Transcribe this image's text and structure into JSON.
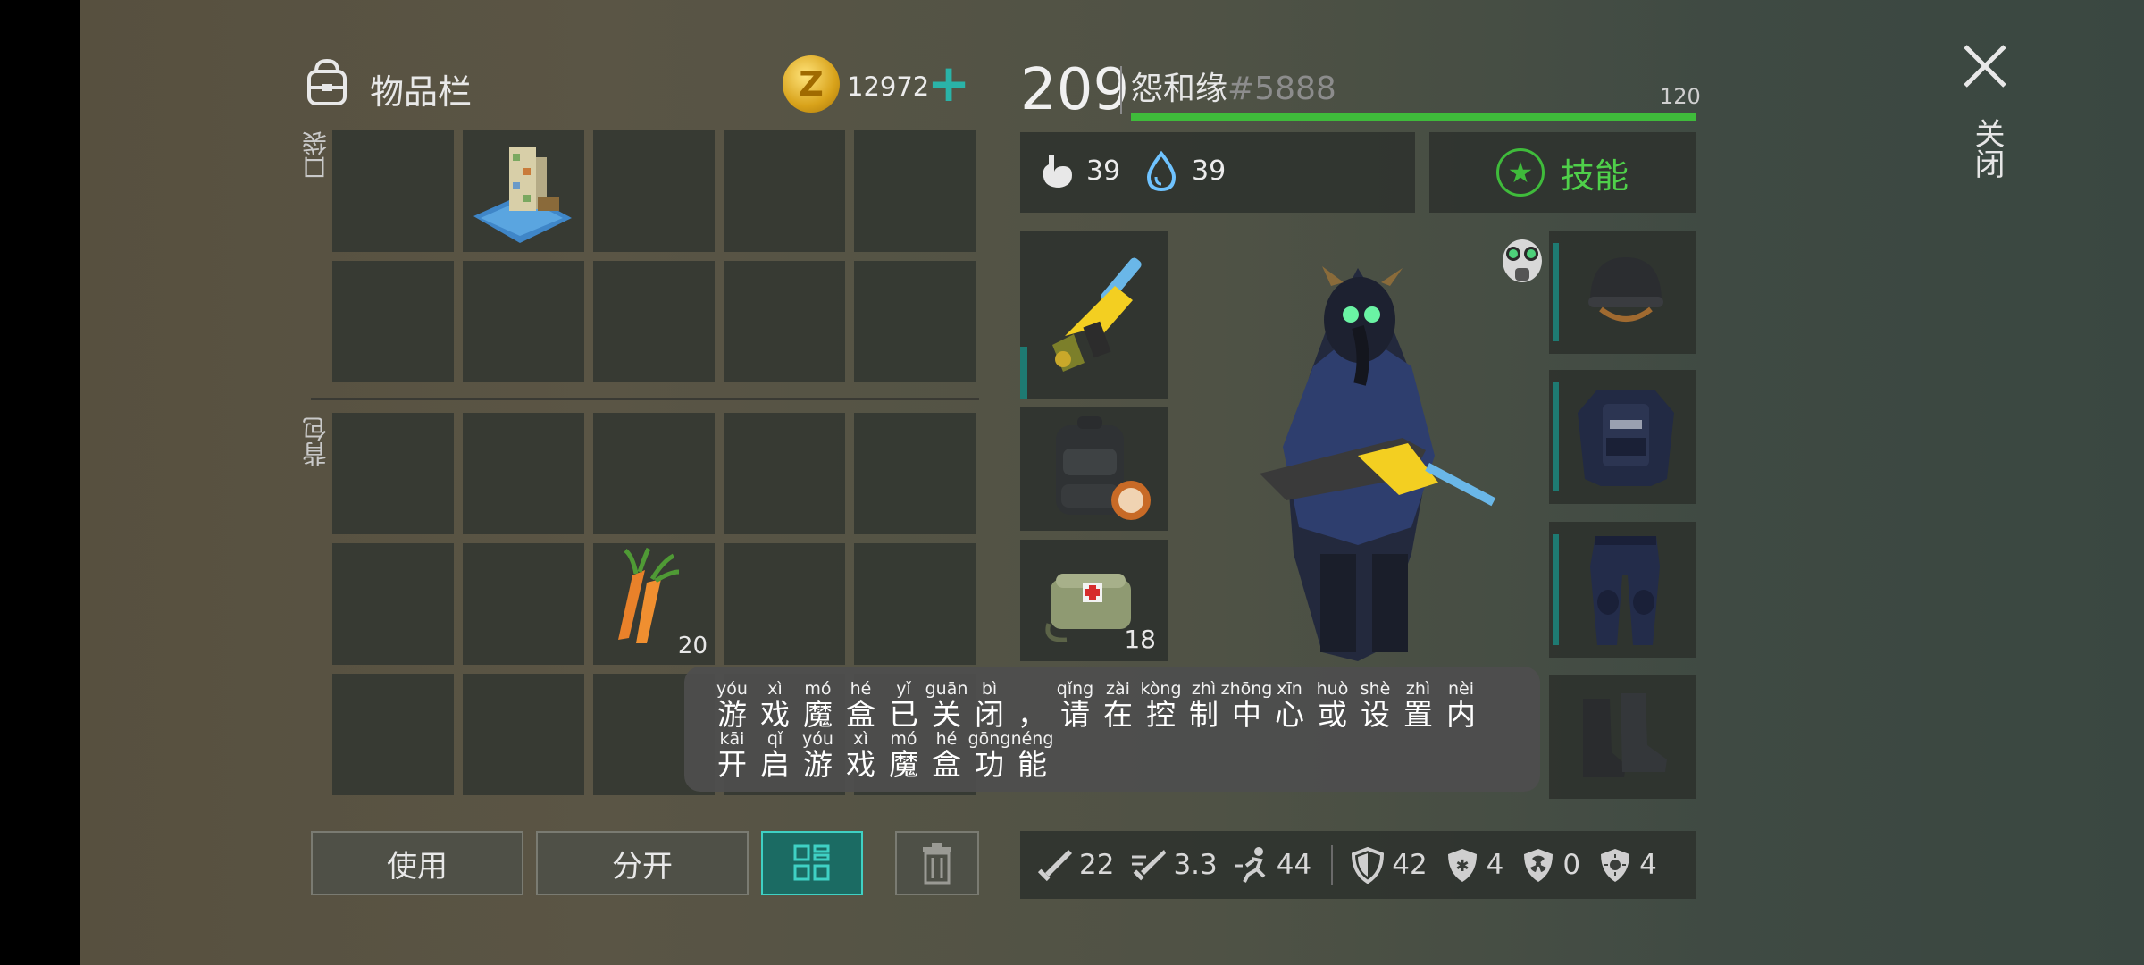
{
  "inventory": {
    "title": "物品栏",
    "coins": "12972",
    "pocket_label": "口袋",
    "backpack_label": "背包",
    "pocket_items": [
      {
        "slot": 1,
        "name": "building-kit-icon"
      }
    ],
    "backpack_items": [
      {
        "slot": 7,
        "name": "carrot-icon",
        "qty": "20"
      }
    ]
  },
  "buttons": {
    "use": "使用",
    "split": "分开"
  },
  "player": {
    "level": "209",
    "name": "怨和缘",
    "tag": "#5888",
    "xp_cap": "120",
    "xp_fill": 1.0,
    "hunger": "39",
    "thirst": "39",
    "skills_label": "技能"
  },
  "quick_slots": [
    {
      "name": "yellow-weapon-icon",
      "qty": ""
    },
    {
      "name": "backpack-icon",
      "qty": ""
    },
    {
      "name": "medkit-bag-icon",
      "qty": "18"
    }
  ],
  "equipment": [
    "helmet-icon",
    "body-armor-icon",
    "pants-icon",
    "boots-icon"
  ],
  "combat_stats": {
    "damage": "22",
    "attack_speed": "3.3",
    "move_speed": "44",
    "armor": "42",
    "cold_resist": "4",
    "radiation_resist": "0",
    "heat_resist": "4"
  },
  "close_label": "关闭",
  "toast": {
    "line1": [
      {
        "py": "yóu",
        "hz": "游"
      },
      {
        "py": "xì",
        "hz": "戏"
      },
      {
        "py": "mó",
        "hz": "魔"
      },
      {
        "py": "hé",
        "hz": "盒"
      },
      {
        "py": "yǐ",
        "hz": "已"
      },
      {
        "py": "guān",
        "hz": "关"
      },
      {
        "py": "bì",
        "hz": "闭"
      },
      {
        "py": "",
        "hz": "，"
      },
      {
        "py": "qǐng",
        "hz": "请"
      },
      {
        "py": "zài",
        "hz": "在"
      },
      {
        "py": "kòng",
        "hz": "控"
      },
      {
        "py": "zhì",
        "hz": "制"
      },
      {
        "py": "zhōng",
        "hz": "中"
      },
      {
        "py": "xīn",
        "hz": "心"
      },
      {
        "py": "huò",
        "hz": "或"
      },
      {
        "py": "shè",
        "hz": "设"
      },
      {
        "py": "zhì",
        "hz": "置"
      },
      {
        "py": "nèi",
        "hz": "内"
      }
    ],
    "line2": [
      {
        "py": "kāi",
        "hz": "开"
      },
      {
        "py": "qǐ",
        "hz": "启"
      },
      {
        "py": "yóu",
        "hz": "游"
      },
      {
        "py": "xì",
        "hz": "戏"
      },
      {
        "py": "mó",
        "hz": "魔"
      },
      {
        "py": "hé",
        "hz": "盒"
      },
      {
        "py": "gōng",
        "hz": "功"
      },
      {
        "py": "néng",
        "hz": "能"
      }
    ]
  },
  "colors": {
    "accent": "#2ab3a8",
    "xp_green": "#3fbb3b",
    "skill_green": "#4fd04a"
  }
}
